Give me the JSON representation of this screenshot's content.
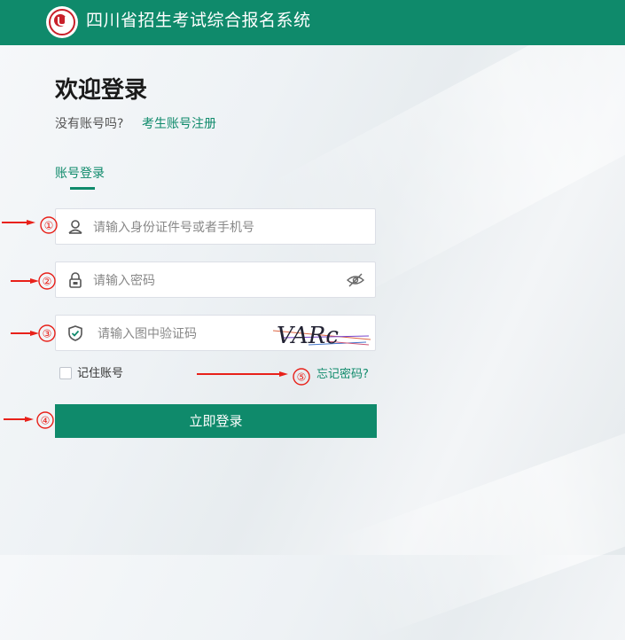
{
  "header": {
    "title": "四川省招生考试综合报名系统"
  },
  "login": {
    "heading": "欢迎登录",
    "no_account": "没有账号吗?",
    "register_link": "考生账号注册",
    "tab": "账号登录",
    "id_placeholder": "请输入身份证件号或者手机号",
    "password_placeholder": "请输入密码",
    "captcha_placeholder": "请输入图中验证码",
    "captcha_text": "VARc",
    "remember_label": "记住账号",
    "forgot_link": "忘记密码?",
    "submit_label": "立即登录"
  },
  "annotations": {
    "n1": "①",
    "n2": "②",
    "n3": "③",
    "n4": "④",
    "n5": "⑤"
  },
  "colors": {
    "brand": "#0f8a6b",
    "annotation": "#e8211a",
    "logo": "#c8202a"
  },
  "icons": [
    "logo-emblem",
    "user-icon",
    "lock-icon",
    "shield-icon",
    "eye-hidden-icon",
    "arrow-icon"
  ]
}
